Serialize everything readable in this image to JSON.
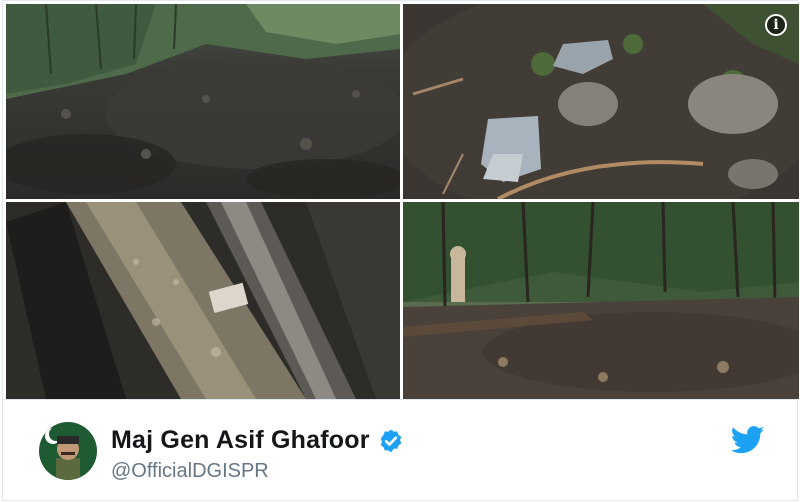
{
  "tweet": {
    "author_name": "Maj Gen Asif Ghafoor",
    "author_handle": "@OfficialDGISPR",
    "verified": true
  },
  "media": {
    "photo_count": 4,
    "info_icon": "info-icon"
  },
  "icons": {
    "verified": "verified-badge-icon",
    "logo": "twitter-bird-icon"
  },
  "colors": {
    "twitter_blue": "#1da1f2",
    "name_text": "#14171a",
    "handle_text": "#657786",
    "border": "#e1e8ed"
  }
}
